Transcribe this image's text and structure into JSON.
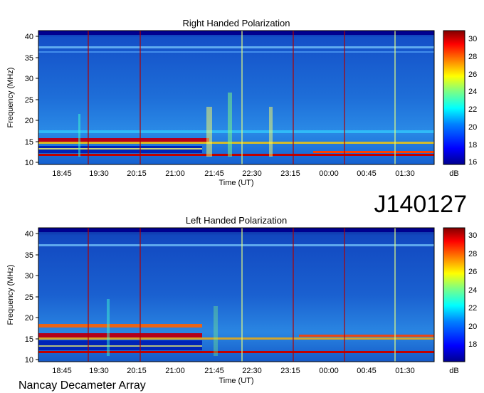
{
  "figure_id": "J140127",
  "footer": "Nancay Decameter Array",
  "chart_data": [
    {
      "type": "heatmap",
      "title": "Right Handed Polarization",
      "xlabel": "Time (UT)",
      "ylabel": "Frequency (MHz)",
      "x_ticks": [
        "18:45",
        "19:30",
        "20:15",
        "21:00",
        "21:45",
        "22:30",
        "23:15",
        "00:00",
        "00:45",
        "01:30"
      ],
      "y_ticks": [
        10,
        15,
        20,
        25,
        30,
        35,
        40
      ],
      "ylim": [
        10,
        40
      ],
      "colorbar": {
        "label": "dB",
        "ticks": [
          16,
          18,
          20,
          22,
          24,
          26,
          28,
          30
        ],
        "range": [
          16,
          31
        ]
      },
      "colormap": [
        "#00008f",
        "#0000ff",
        "#0080ff",
        "#00ffff",
        "#80ff80",
        "#ffff00",
        "#ff8000",
        "#ff0000",
        "#800000"
      ],
      "features": {
        "background_db": 19.5,
        "vertical_lines_time": [
          "19:22",
          "20:32",
          "23:17",
          "00:27",
          "01:07"
        ],
        "bright_line_time": [
          "22:23",
          "01:37"
        ],
        "strong_bands_mhz": [
          16.0,
          15.0,
          11.8,
          13.5,
          18.0
        ]
      }
    },
    {
      "type": "heatmap",
      "title": "Left Handed Polarization",
      "xlabel": "Time (UT)",
      "ylabel": "Frequency (MHz)",
      "x_ticks": [
        "18:45",
        "19:30",
        "20:15",
        "21:00",
        "21:45",
        "22:30",
        "23:15",
        "00:00",
        "00:45",
        "01:30"
      ],
      "y_ticks": [
        10,
        15,
        20,
        25,
        30,
        35,
        40
      ],
      "ylim": [
        10,
        40
      ],
      "colorbar": {
        "label": "dB",
        "ticks": [
          18,
          20,
          22,
          24,
          26,
          28,
          30
        ],
        "range": [
          16.5,
          31
        ]
      },
      "colormap": [
        "#00008f",
        "#0000ff",
        "#0080ff",
        "#00ffff",
        "#80ff80",
        "#ffff00",
        "#ff8000",
        "#ff0000",
        "#800000"
      ],
      "features": {
        "background_db": 19.5,
        "vertical_lines_time": [
          "19:22",
          "20:32",
          "23:17",
          "00:27",
          "01:07"
        ],
        "bright_line_time": [
          "22:23",
          "01:37"
        ],
        "strong_bands_mhz": [
          15.8,
          14.9,
          11.8,
          17.8
        ]
      }
    }
  ]
}
